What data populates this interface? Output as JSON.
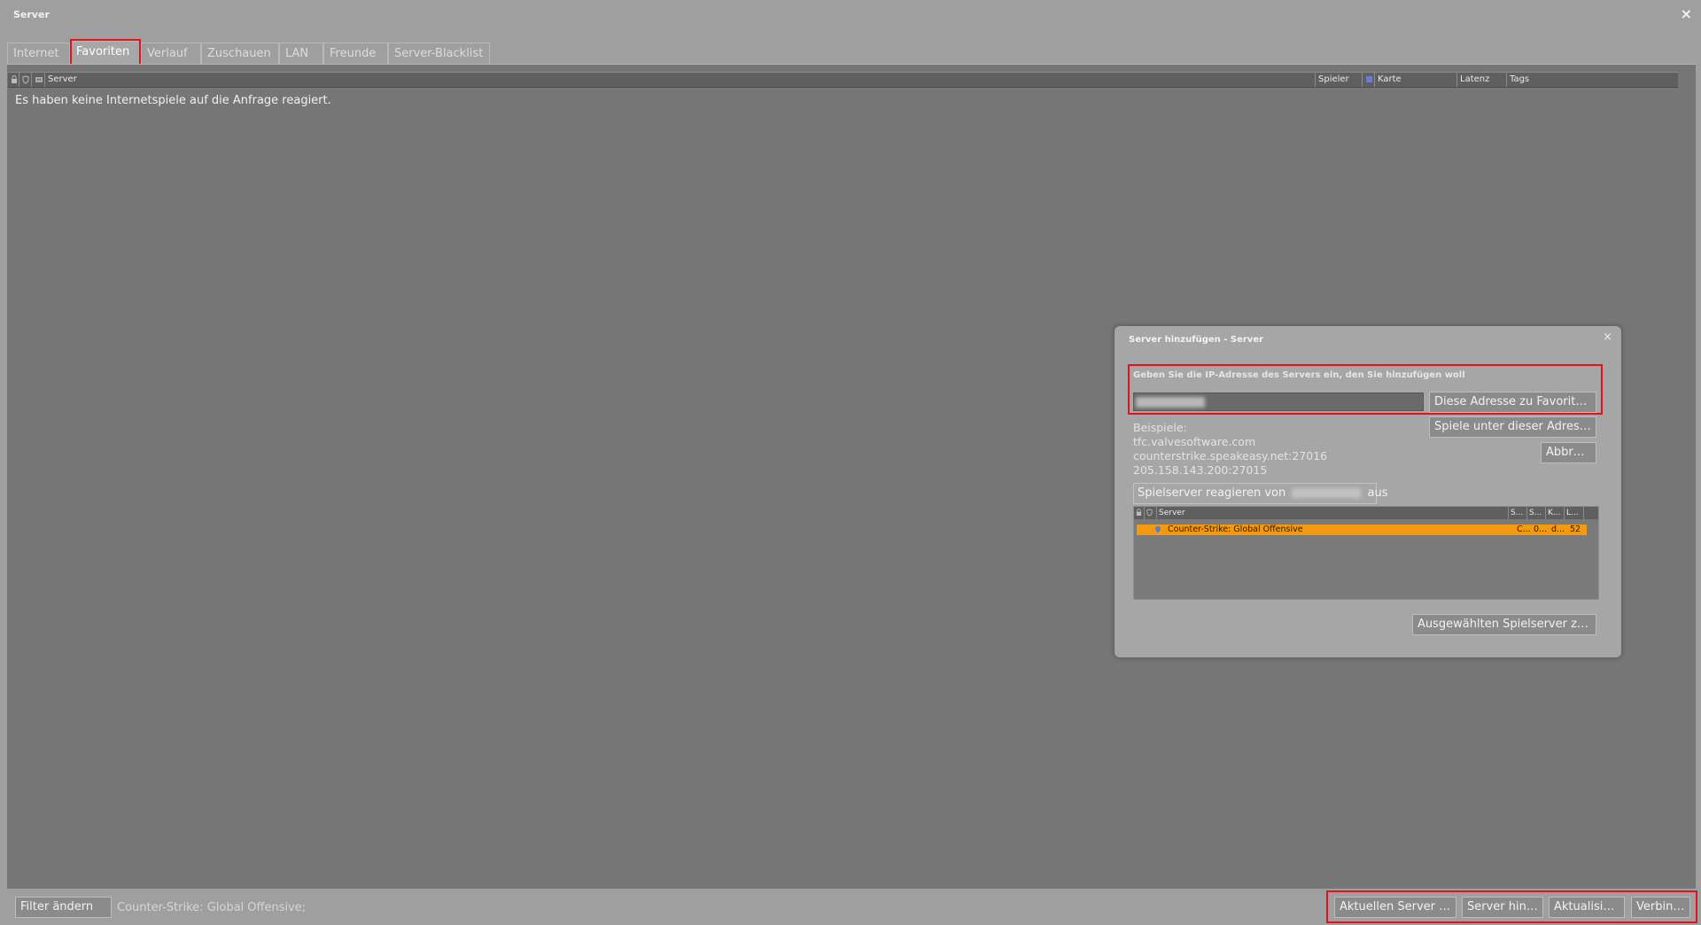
{
  "window": {
    "title": "Server",
    "close_symbol": "×"
  },
  "tabs": [
    {
      "label": "Internet",
      "active": false
    },
    {
      "label": "Favoriten",
      "active": true
    },
    {
      "label": "Verlauf",
      "active": false
    },
    {
      "label": "Zuschauen",
      "active": false
    },
    {
      "label": "LAN",
      "active": false
    },
    {
      "label": "Freunde",
      "active": false
    },
    {
      "label": "Server-Blacklist",
      "active": false
    }
  ],
  "table": {
    "header_icons": [
      "lock-icon",
      "shield-icon",
      "bot-icon"
    ],
    "columns": {
      "server": "Server",
      "players": "Spieler",
      "map": "Karte",
      "latency": "Latenz",
      "tags": "Tags"
    },
    "empty_message": "Es haben keine Internetspiele auf die Anfrage reagiert."
  },
  "footer": {
    "filter_button": "Filter ändern",
    "status_text": "Counter-Strike: Global Offensive;",
    "add_current_button": "Aktuellen Server hinz...",
    "add_server_button": "Server hinzu...",
    "refresh_button": "Aktualisieren",
    "connect_button": "Verbinden"
  },
  "dialog": {
    "title": "Server hinzufügen - Server",
    "close_symbol": "×",
    "prompt": "Geben Sie die IP-Adresse des Servers ein, den Sie hinzufügen woll",
    "add_to_favorites_button": "Diese Adresse zu Favoriten hi...",
    "find_games_button": "Spiele unter dieser Adresse s...",
    "cancel_button": "Abbrec...",
    "examples_label": "Beispiele:",
    "examples": [
      "tfc.valvesoftware.com",
      "counterstrike.speakeasy.net:27016",
      "205.158.143.200:27015"
    ],
    "responding_prefix": "Spielserver reagieren von",
    "responding_suffix": "aus",
    "mini_table": {
      "header_icons": [
        "lock-icon",
        "shield-icon"
      ],
      "columns": {
        "server": "Server",
        "c1": "S...",
        "c2": "S...",
        "c3": "K...",
        "c4": "L..."
      },
      "rows": [
        {
          "name": "Counter-Strike: Global Offensive",
          "c1": "C...",
          "c2": "0...",
          "c3": "d...",
          "c4": "52",
          "selected": true
        }
      ]
    },
    "add_selected_button": "Ausgewählten Spielserver zu Fav..."
  },
  "colors": {
    "highlight_red": "#e8101a",
    "selected_row": "#f39a10"
  }
}
